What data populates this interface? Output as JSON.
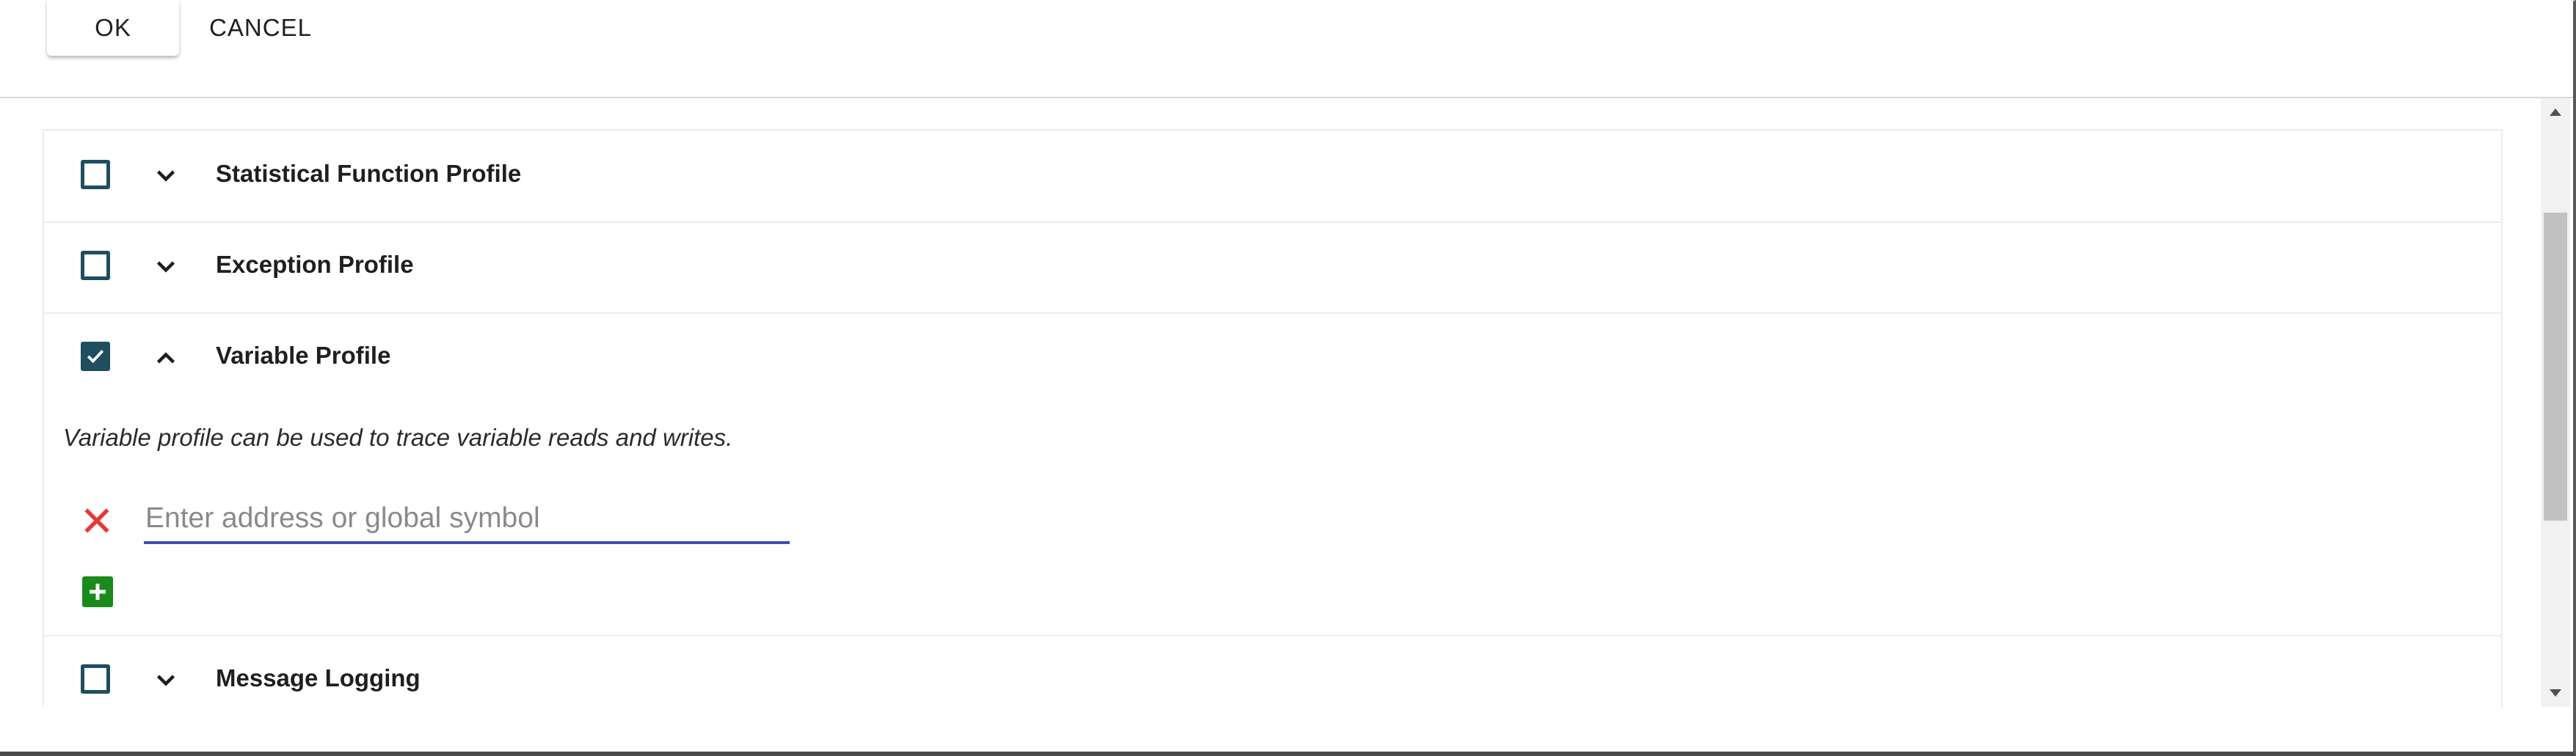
{
  "actions": {
    "ok_label": "OK",
    "cancel_label": "CANCEL"
  },
  "profiles": [
    {
      "title": "Statistical Function Profile",
      "checked": false,
      "expanded": false,
      "chevron_icon": "chevron-down-icon"
    },
    {
      "title": "Exception Profile",
      "checked": false,
      "expanded": false,
      "chevron_icon": "chevron-down-icon"
    },
    {
      "title": "Variable Profile",
      "checked": true,
      "expanded": true,
      "chevron_icon": "chevron-up-icon",
      "description": "Variable profile can be used to trace variable reads and writes.",
      "address_input": {
        "value": "",
        "placeholder": "Enter address or global symbol"
      },
      "remove_icon": "close-icon",
      "add_icon": "plus-icon"
    },
    {
      "title": "Message Logging",
      "checked": false,
      "expanded": false,
      "chevron_icon": "chevron-down-icon"
    }
  ],
  "colors": {
    "checkbox": "#1f4e5f",
    "input_underline": "#3f4fb5",
    "remove_icon": "#e53935",
    "add_button": "#1a8a1a"
  }
}
